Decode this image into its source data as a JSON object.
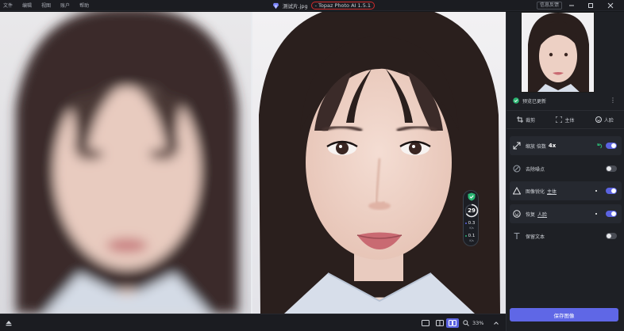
{
  "menu": [
    "文件",
    "编辑",
    "视图",
    "账户",
    "帮助"
  ],
  "window": {
    "file_name": "测试片.jpg",
    "separator": " - ",
    "app_name": "Topaz Photo AI 1.5.1",
    "feedback_label": "信息反馈"
  },
  "badge": {
    "score": "29",
    "value1": "0.3",
    "unit1": "K/s",
    "value2": "0.1",
    "unit2": "K/s"
  },
  "bottom": {
    "zoom": "33%"
  },
  "panel": {
    "preview_status": "预览已更新",
    "tools": [
      "裁剪",
      "主体",
      "人脸"
    ],
    "rows": {
      "upscale_label": "缩放 倍数",
      "upscale_value": "4x",
      "denoise_label": "去除噪点",
      "sharpen_label": "图像锐化",
      "sharpen_link": "主体",
      "recover_label": "恢复",
      "recover_link": "人脸",
      "text_label": "保留文本"
    },
    "save_label": "保存图像"
  },
  "colors": {
    "accent": "#5f67e6",
    "badge_green": "#2bb673",
    "title_highlight": "#d12b2b"
  }
}
